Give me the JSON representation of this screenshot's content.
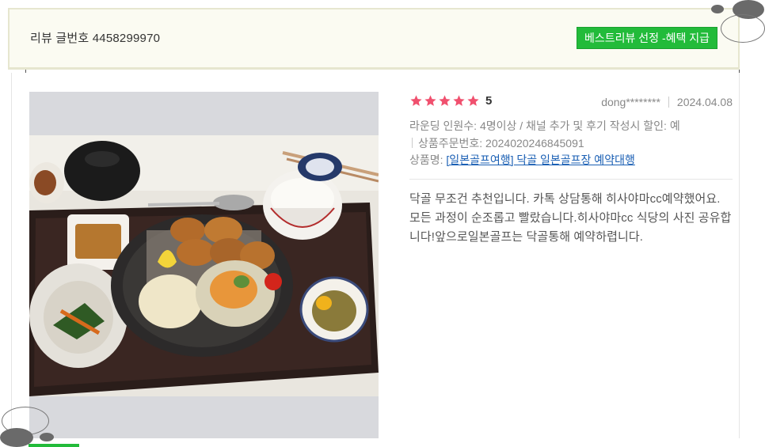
{
  "header": {
    "review_number_label": "리뷰 글번호 4458299970",
    "best_review_badge": "베스트리뷰 선정 -혜택 지급"
  },
  "review": {
    "rating": 5,
    "rating_text": "5",
    "stars_total": 5,
    "author": "dong********",
    "date": "2024.04.08",
    "option_text": "라운딩 인원수: 4명이상 / 채널 추가 및 후기 작성시 할인: 예",
    "order_number_label": "상품주문번호: 2024020246845091",
    "product_label": "상품명:",
    "product_link": "[일본골프여행] 닥골 일본골프장 예약대행",
    "body": "닥골 무조건 추천입니다. 카톡 상담통해 히사야마cc예약했어요. 모든 과정이 순조롭고 빨랐습니다.히사야마cc 식당의 사진 공유합니다!앞으로일본골프는 닥골통해 예약하렵니다.",
    "photo_icon": "food-photo"
  },
  "colors": {
    "star": "#f0506e",
    "badge": "#22bb3a",
    "link": "#1a5fb4"
  }
}
